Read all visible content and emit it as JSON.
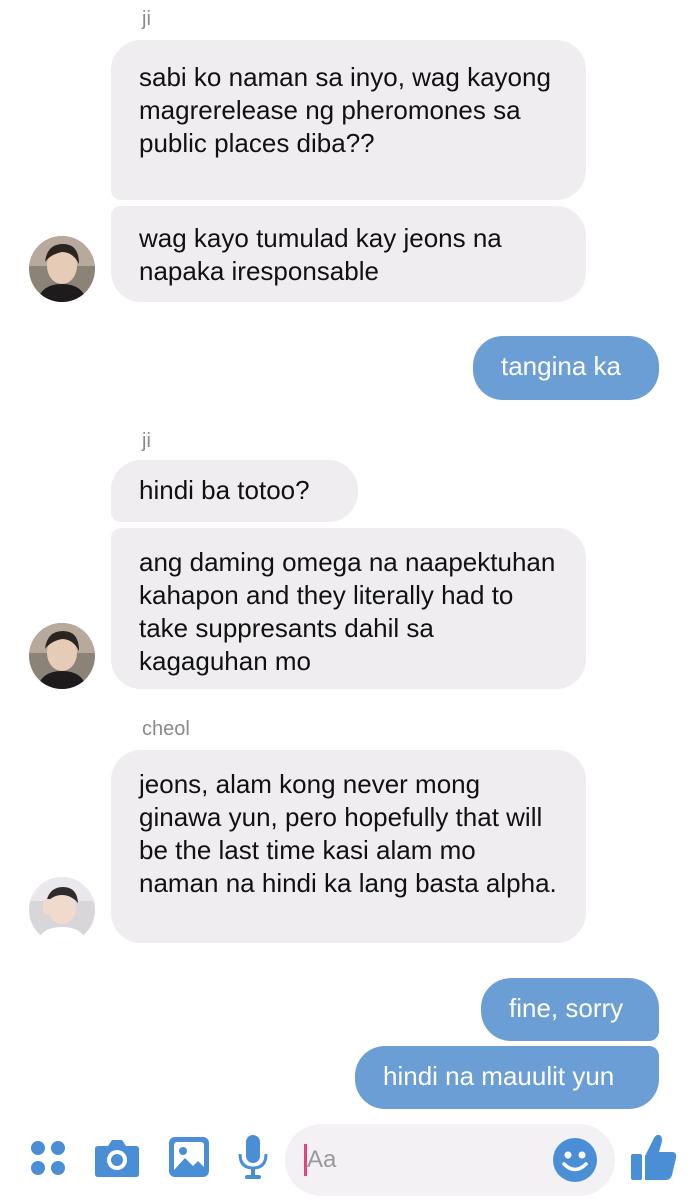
{
  "conversation": {
    "groups": [
      {
        "sender": "ji",
        "messages": [
          "sabi ko naman sa inyo, wag kayong magrerelease ng pheromones sa public places diba??",
          "wag kayo tumulad kay jeons na napaka iresponsable"
        ]
      },
      {
        "outgoing": [
          "tangina ka"
        ]
      },
      {
        "sender": "ji",
        "messages": [
          "hindi ba totoo?",
          "ang daming omega na naapektuhan kahapon and they literally had to take suppresants dahil sa kagaguhan mo"
        ]
      },
      {
        "sender": "cheol",
        "messages": [
          "jeons, alam kong never mong ginawa yun, pero hopefully that will be the last time kasi alam mo naman na hindi ka lang basta alpha."
        ]
      },
      {
        "outgoing": [
          "fine, sorry",
          "hindi na mauulit yun"
        ]
      }
    ]
  },
  "composer": {
    "placeholder": "Aa",
    "icons": [
      "apps-icon",
      "camera-icon",
      "gallery-icon",
      "microphone-icon",
      "emoji-icon",
      "thumbs-up-icon"
    ]
  },
  "colors": {
    "outgoing_bubble": "#6a9ed4",
    "incoming_bubble": "#efedf0",
    "accent": "#4a8fd6"
  }
}
